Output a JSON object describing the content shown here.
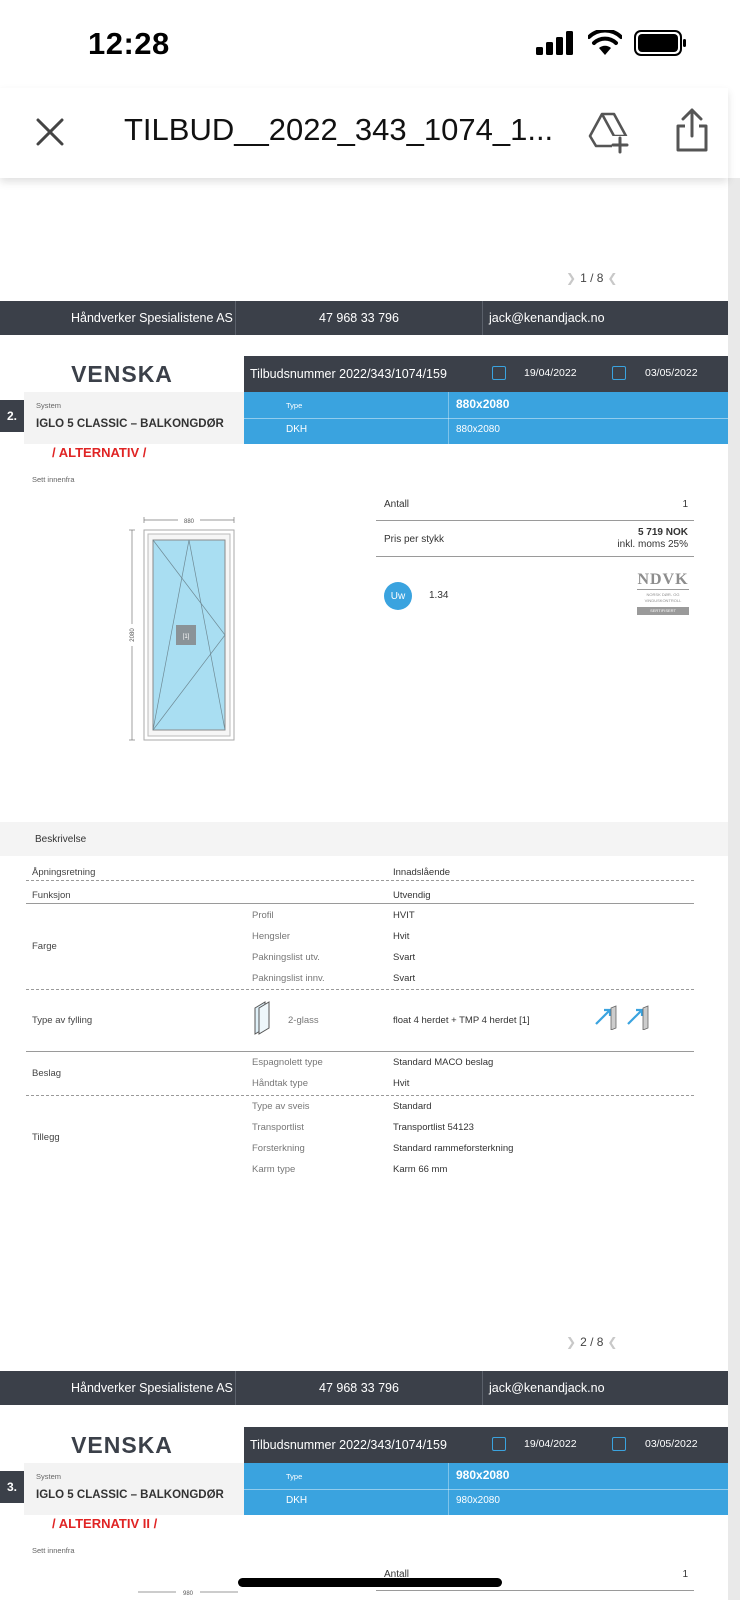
{
  "status_bar": {
    "time": "12:28"
  },
  "top_bar": {
    "title": "TILBUD__2022_343_1074_1..."
  },
  "footer": {
    "company": "Håndverker Spesialistene AS",
    "phone": "47 968 33 796",
    "email": "jack@kenandjack.no"
  },
  "page1": {
    "page_num": "1 / 8"
  },
  "header": {
    "logo": "VENSKA",
    "offer_number": "Tilbudsnummer 2022/343/1074/159",
    "date_created": "19/04/2022",
    "date_valid": "03/05/2022"
  },
  "item2": {
    "number": "2.",
    "system_label": "System",
    "system_name": "IGLO 5 CLASSIC – BALKONGDØR",
    "type_label": "Type",
    "type_value": "880x2080",
    "dkh_label": "DKH",
    "dkh_value": "880x2080",
    "alternative": "/ ALTERNATIV /",
    "view_label": "Sett innenfra",
    "drawing": {
      "width_label": "880",
      "height_label": "2080",
      "glass_label": "[1]"
    },
    "quantity_label": "Antall",
    "quantity_value": "1",
    "price_label": "Pris per stykk",
    "price_value": "5 719 NOK",
    "price_vat": "inkl. moms 25%",
    "uw_label": "Uw",
    "uw_value": "1.34",
    "cert": {
      "name": "NDVK",
      "line1": "NORSK DØR- OG",
      "line2": "VINDUSKONTROLL",
      "line3": "SERTIFISERT"
    },
    "description_label": "Beskrivelse",
    "rows": {
      "opening_label": "Åpningsretning",
      "opening_value": "Innadslående",
      "function_label": "Funksjon",
      "function_value": "Utvendig",
      "color_label": "Farge",
      "profile_label": "Profil",
      "profile_value": "HVIT",
      "hinges_label": "Hengsler",
      "hinges_value": "Hvit",
      "gasket_out_label": "Pakningslist utv.",
      "gasket_out_value": "Svart",
      "gasket_in_label": "Pakningslist innv.",
      "gasket_in_value": "Svart",
      "filling_label": "Type av fylling",
      "filling_sub": "2-glass",
      "filling_value": "float 4 herdet + TMP 4 herdet [1]",
      "hardware_label": "Beslag",
      "espag_label": "Espagnolett type",
      "espag_value": "Standard MACO beslag",
      "handle_label": "Håndtak type",
      "handle_value": "Hvit",
      "extra_label": "Tillegg",
      "weld_label": "Type av sveis",
      "weld_value": "Standard",
      "transport_label": "Transportlist",
      "transport_value": "Transportlist 54123",
      "reinf_label": "Forsterkning",
      "reinf_value": "Standard rammeforsterkning",
      "frame_label": "Karm type",
      "frame_value": "Karm 66 mm"
    },
    "page_num": "2 / 8"
  },
  "item3": {
    "number": "3.",
    "system_label": "System",
    "system_name": "IGLO 5 CLASSIC – BALKONGDØR",
    "type_label": "Type",
    "type_value": "980x2080",
    "dkh_label": "DKH",
    "dkh_value": "980x2080",
    "alternative": "/ ALTERNATIV II /",
    "view_label": "Sett innenfra",
    "quantity_label": "Antall",
    "quantity_value": "1",
    "width_label": "980"
  }
}
